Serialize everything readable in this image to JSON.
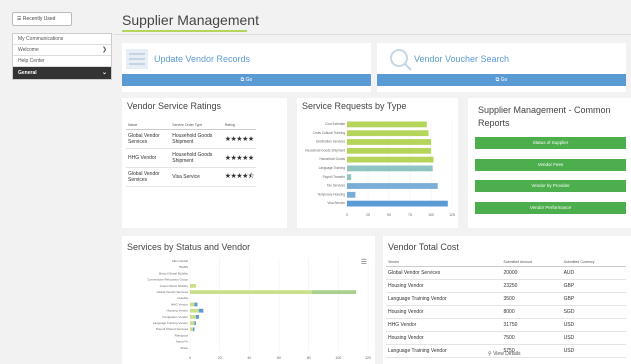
{
  "sidebar": {
    "recently_used": "Recently Used",
    "items": [
      {
        "label": "My Communications"
      },
      {
        "label": "Welcome"
      },
      {
        "label": "Help Center"
      },
      {
        "label": "General"
      }
    ]
  },
  "page": {
    "title": "Supplier Management"
  },
  "tiles": [
    {
      "title": "Update Vendor Records",
      "go": "Go"
    },
    {
      "title": "Vendor Voucher Search",
      "go": "Go"
    }
  ],
  "ratings": {
    "title": "Vendor Service Ratings",
    "headers": [
      "Name",
      "Service Order Type",
      "Rating"
    ],
    "rows": [
      {
        "name": "Global Vendor Services",
        "type": "Household Goods Shipment",
        "rating": 5
      },
      {
        "name": "HHG Vendor",
        "type": "Household Goods Shipment",
        "rating": 5
      },
      {
        "name": "Global Vendor Services",
        "type": "Visa Service",
        "rating": 4.5
      }
    ]
  },
  "requests": {
    "title": "Service Requests by Type",
    "chart_data": {
      "type": "bar",
      "orientation": "horizontal",
      "categories": [
        "Cost Estimate",
        "Cross Cultural Training",
        "Destination Services",
        "Household Goods Shipment",
        "Household Goods",
        "Language Training",
        "Payroll Transfer",
        "Tax Services",
        "Temporary Housing",
        "Visa Service"
      ],
      "values": [
        95,
        97,
        100,
        100,
        103,
        102,
        5,
        108,
        10,
        120
      ],
      "colors": [
        "#b5d45a",
        "#b5d45a",
        "#b5d45a",
        "#b5d45a",
        "#b5d45a",
        "#8fc4c0",
        "#8fc4c0",
        "#7aaed6",
        "#7aaed6",
        "#5b9bd5"
      ],
      "xticks": [
        "0",
        "25",
        "50",
        "75",
        "100",
        "125"
      ],
      "xlim": [
        0,
        125
      ]
    }
  },
  "common_reports": {
    "title": "Supplier Management - Common Reports",
    "buttons": [
      "Status of Supplier",
      "Vendor Fees",
      "Vendor by Provider",
      "Vendor Performance"
    ]
  },
  "status": {
    "title": "Services by Status and Vendor",
    "chart_data": {
      "type": "bar",
      "orientation": "horizontal",
      "stacked": true,
      "categories": [
        "Allen Global",
        "BGRS",
        "Bristol Global Mobility",
        "Cornerstone Relocation Group",
        "Crown World Mobility",
        "Global Vendor Services",
        "Graebel",
        "HHG Vendor",
        "Housing Vendor",
        "Immigration Vendor",
        "Language Training Vendor",
        "Payroll Shared Services",
        "Relocpool",
        "Santa Fe",
        "Sirelo"
      ],
      "series": [
        {
          "values": [
            0,
            0,
            0,
            0,
            4,
            82,
            0,
            3,
            6,
            4,
            3,
            2,
            0,
            0,
            0
          ],
          "color": "#c9e08a"
        },
        {
          "values": [
            0,
            0,
            0,
            0,
            0,
            30,
            0,
            0,
            0,
            0,
            0,
            0,
            0,
            0,
            0
          ],
          "color": "#a9d08e"
        },
        {
          "values": [
            0,
            0,
            0,
            0,
            0,
            0,
            0,
            2,
            3,
            2,
            1,
            1,
            0,
            0,
            0
          ],
          "color": "#5b9bd5"
        }
      ],
      "xticks": [
        "0",
        "20",
        "40",
        "60",
        "80",
        "100",
        "120"
      ],
      "xlim": [
        0,
        120
      ],
      "menu_icon": "hamburger-icon"
    }
  },
  "total_cost": {
    "title": "Vendor Total Cost",
    "headers": [
      "Vendor",
      "Submitted Amount",
      "Submitted Currency"
    ],
    "rows": [
      [
        "Global Vendor Services",
        "20000",
        "AUD"
      ],
      [
        "Housing Vendor",
        "23250",
        "GBP"
      ],
      [
        "Language Training Vendor",
        "3500",
        "GBP"
      ],
      [
        "Housing Vendor",
        "8000",
        "SGD"
      ],
      [
        "HHG Vendor",
        "31750",
        "USD"
      ],
      [
        "Housing Vendor",
        "7500",
        "USD"
      ],
      [
        "Language Training Vendor",
        "5750",
        "USD"
      ]
    ],
    "view_details": "View Details"
  }
}
